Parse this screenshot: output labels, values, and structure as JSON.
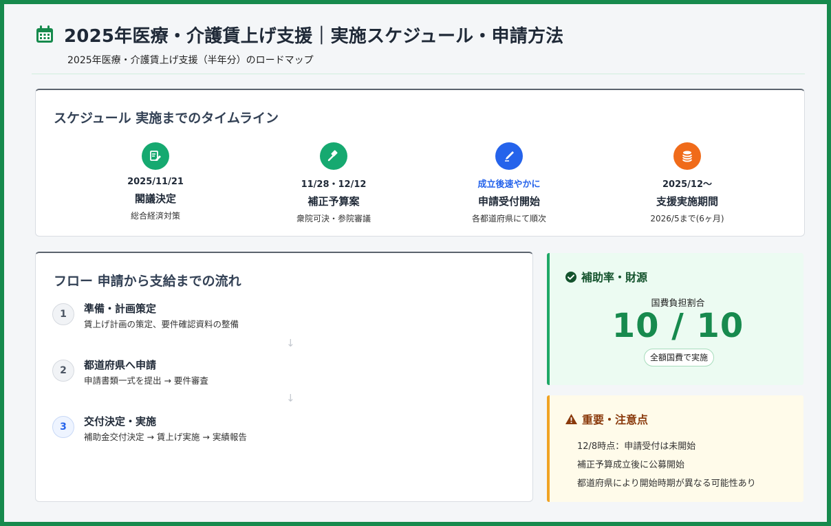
{
  "header": {
    "title": "2025年医療・介護賃上げ支援｜実施スケジュール・申請方法",
    "subtitle": "2025年医療・介護賃上げ支援（半年分）のロードマップ"
  },
  "timeline": {
    "section_title": "スケジュール 実施までのタイムライン",
    "items": [
      {
        "date": "2025/11/21",
        "title": "閣議決定",
        "sub": "総合経済対策",
        "color": "#16a970",
        "icon": "document-edit-icon"
      },
      {
        "date": "11/28・12/12",
        "title": "補正予算案",
        "sub": "衆院可決・参院審議",
        "color": "#16a970",
        "icon": "gavel-icon"
      },
      {
        "date": "成立後速やかに",
        "title": "申請受付開始",
        "sub": "各都道府県にて順次",
        "color": "#2563eb",
        "icon": "pen-icon"
      },
      {
        "date": "2025/12〜",
        "title": "支援実施期間",
        "sub": "2026/5まで(6ヶ月)",
        "color": "#f06b1a",
        "icon": "coins-icon"
      }
    ]
  },
  "flow": {
    "section_title": "フロー 申請から支給までの流れ",
    "steps": [
      {
        "num": "1",
        "title": "準備・計画策定",
        "desc": "賃上げ計画の策定、要件確認資料の整備"
      },
      {
        "num": "2",
        "title": "都道府県へ申請",
        "desc": "申請書類一式を提出 → 要件審査"
      },
      {
        "num": "3",
        "title": "交付決定・実施",
        "desc": "補助金交付決定 → 賃上げ実施 → 実績報告"
      }
    ],
    "arrow": "↓"
  },
  "subsidy": {
    "title": "補助率・財源",
    "rate_label": "国費負担割合",
    "rate_value": "10 / 10",
    "badge": "全額国費で実施",
    "accent": "#1ea866"
  },
  "notice": {
    "title": "重要・注意点",
    "items": [
      "12/8時点：申請受付は未開始",
      "補正予算成立後に公募開始",
      "都道府県により開始時期が異なる可能性あり"
    ],
    "accent": "#f0a323"
  }
}
